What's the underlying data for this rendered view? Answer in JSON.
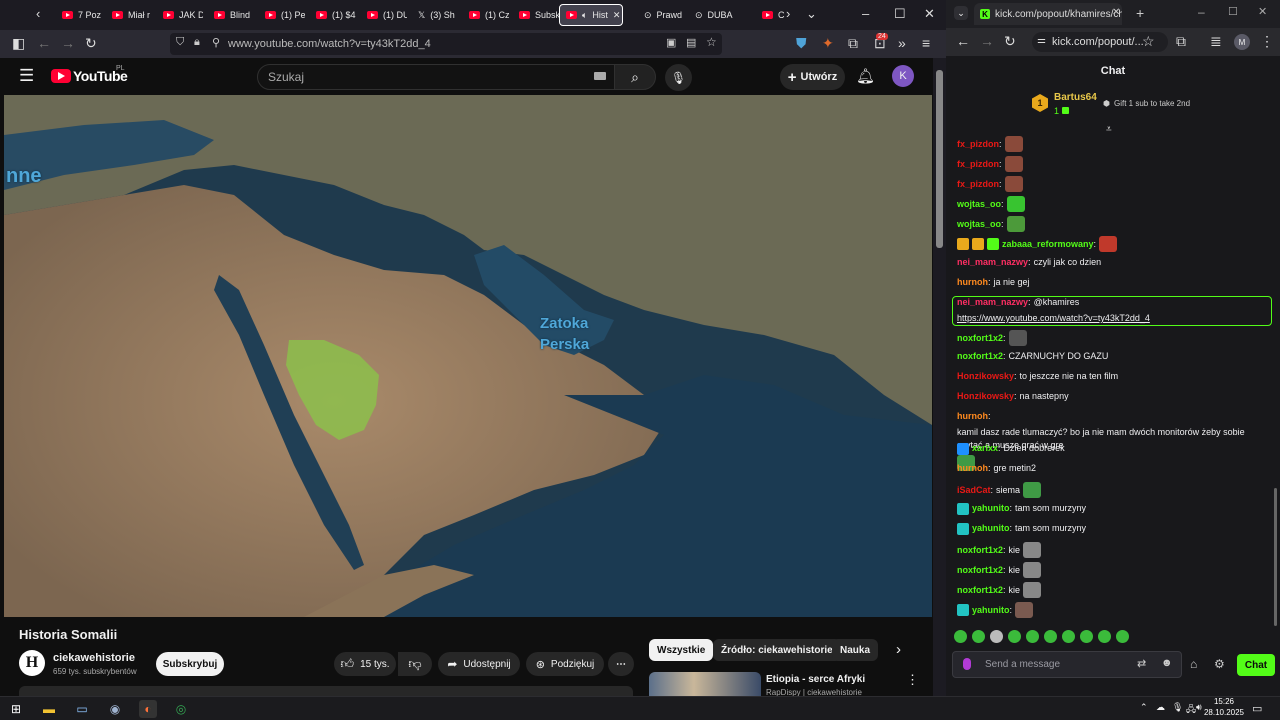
{
  "left_browser": {
    "tabs": [
      {
        "label": "7 Poz",
        "kind": "youtube"
      },
      {
        "label": "Miał r",
        "kind": "youtube"
      },
      {
        "label": "JAK D",
        "kind": "youtube"
      },
      {
        "label": "Blind",
        "kind": "youtube"
      },
      {
        "label": "(1) Pe",
        "kind": "youtube"
      },
      {
        "label": "(1) $4",
        "kind": "youtube"
      },
      {
        "label": "(1) DU",
        "kind": "youtube"
      },
      {
        "label": "(3) Sh",
        "kind": "x"
      },
      {
        "label": "(1) Cz",
        "kind": "youtube"
      },
      {
        "label": "Subsk",
        "kind": "youtube"
      },
      {
        "label": "Hist",
        "kind": "youtube-audio",
        "active": true
      },
      {
        "label": "Prawd",
        "kind": "other"
      },
      {
        "label": "DUBA",
        "kind": "other"
      },
      {
        "label": "C",
        "kind": "youtube"
      }
    ],
    "url": "www.youtube.com/watch?v=ty43kT2dd_4",
    "notification_count": "24"
  },
  "youtube": {
    "logo_text": "YouTube",
    "region": "PL",
    "search_placeholder": "Szukaj",
    "create_label": "Utwórz",
    "avatar_letter": "K",
    "map_labels": {
      "sea_partial": "nne",
      "gulf_line1": "Zatoka",
      "gulf_line2": "Perska"
    },
    "video_title": "Historia Somalii",
    "channel": {
      "name": "ciekawehistorie",
      "subs": "659 tys. subskrybentów",
      "avatar_letter": "H"
    },
    "subscribe_label": "Subskrybuj",
    "likes": "15 tys.",
    "share_label": "Udostępnij",
    "thanks_label": "Podziękuj",
    "chips": [
      "Wszystkie",
      "Źródło: ciekawehistorie",
      "Nauka"
    ],
    "recommendation": {
      "title": "Etiopia - serce Afryki",
      "channel": "RapDispy | ciekawehistorie"
    }
  },
  "right_browser": {
    "tab_title": "kick.com/popout/khamires/cha",
    "url": "kick.com/popout/...",
    "profile_letter": "M"
  },
  "chat": {
    "header": "Chat",
    "pinned": {
      "rank": "1",
      "user": "Bartus64",
      "count": "1",
      "cta": "Gift 1 sub to take 2nd"
    },
    "messages": [
      {
        "user": "fx_pizdon",
        "color": "#e91916",
        "text": "",
        "emote": "#8a4a3a"
      },
      {
        "user": "fx_pizdon",
        "color": "#e91916",
        "text": "",
        "emote": "#8a4a3a"
      },
      {
        "user": "fx_pizdon",
        "color": "#e91916",
        "text": "",
        "emote": "#8a4a3a"
      },
      {
        "user": "wojtas_oo",
        "color": "#53fc18",
        "text": "",
        "emote": "#38c430"
      },
      {
        "user": "wojtas_oo",
        "color": "#53fc18",
        "text": "",
        "emote": "#4c9a3a"
      },
      {
        "user": "zabaaa_reformowany",
        "color": "#53fc18",
        "text": "",
        "emote": "#c0392b",
        "badges": [
          "#e9a91c",
          "#e9a91c",
          "#53fc18"
        ]
      },
      {
        "user": "nei_mam_nazwy",
        "color": "#ff2e63",
        "text": "czyli jak co dzien"
      },
      {
        "user": "hurnoh",
        "color": "#ff8a1f",
        "text": "ja nie gej"
      },
      {
        "user": "nei_mam_nazwy",
        "color": "#ff2e63",
        "text": "@khamires ",
        "link": "https://www.youtube.com/watch?v=ty43kT2dd_4",
        "mention": true
      },
      {
        "user": "noxfort1x2",
        "color": "#53fc18",
        "text": "",
        "emote": "#555"
      },
      {
        "user": "noxfort1x2",
        "color": "#53fc18",
        "text": "CZARNUCHY DO GAZU"
      },
      {
        "user": "Honzikowsky",
        "color": "#e91916",
        "text": "to jeszcze nie na ten film"
      },
      {
        "user": "Honzikowsky",
        "color": "#e91916",
        "text": "na nastepny"
      },
      {
        "user": "hurnoh",
        "color": "#ff8a1f",
        "text": "kamil dasz rade tlumaczyć? bo ja nie mam dwóch monitorów żeby sobie czytać a musze grać w gre",
        "emote": "#3f9a45"
      },
      {
        "user": "xarixx",
        "color": "#53fc18",
        "text": "Dzien dobrerek",
        "badges": [
          "#1e90ff"
        ]
      },
      {
        "user": "hurnoh",
        "color": "#ff8a1f",
        "text": "gre metin2"
      },
      {
        "user": "iSadCat",
        "color": "#e91916",
        "text": "siema",
        "emote": "#3f9a45"
      },
      {
        "user": "yahunito",
        "color": "#53fc18",
        "text": "tam som murzyny",
        "badges": [
          "#22c3c3"
        ]
      },
      {
        "user": "yahunito",
        "color": "#53fc18",
        "text": "tam som murzyny",
        "badges": [
          "#22c3c3"
        ]
      },
      {
        "user": "noxfort1x2",
        "color": "#53fc18",
        "text": "kie",
        "emote": "#888"
      },
      {
        "user": "noxfort1x2",
        "color": "#53fc18",
        "text": "kie",
        "emote": "#888"
      },
      {
        "user": "noxfort1x2",
        "color": "#53fc18",
        "text": "kie",
        "emote": "#888"
      },
      {
        "user": "yahunito",
        "color": "#53fc18",
        "text": "",
        "emote": "#7a5a50",
        "badges": [
          "#22c3c3"
        ]
      }
    ],
    "input_placeholder": "Send a message",
    "send_label": "Chat"
  },
  "taskbar": {
    "time": "15:26",
    "date": "28.10.2025"
  }
}
